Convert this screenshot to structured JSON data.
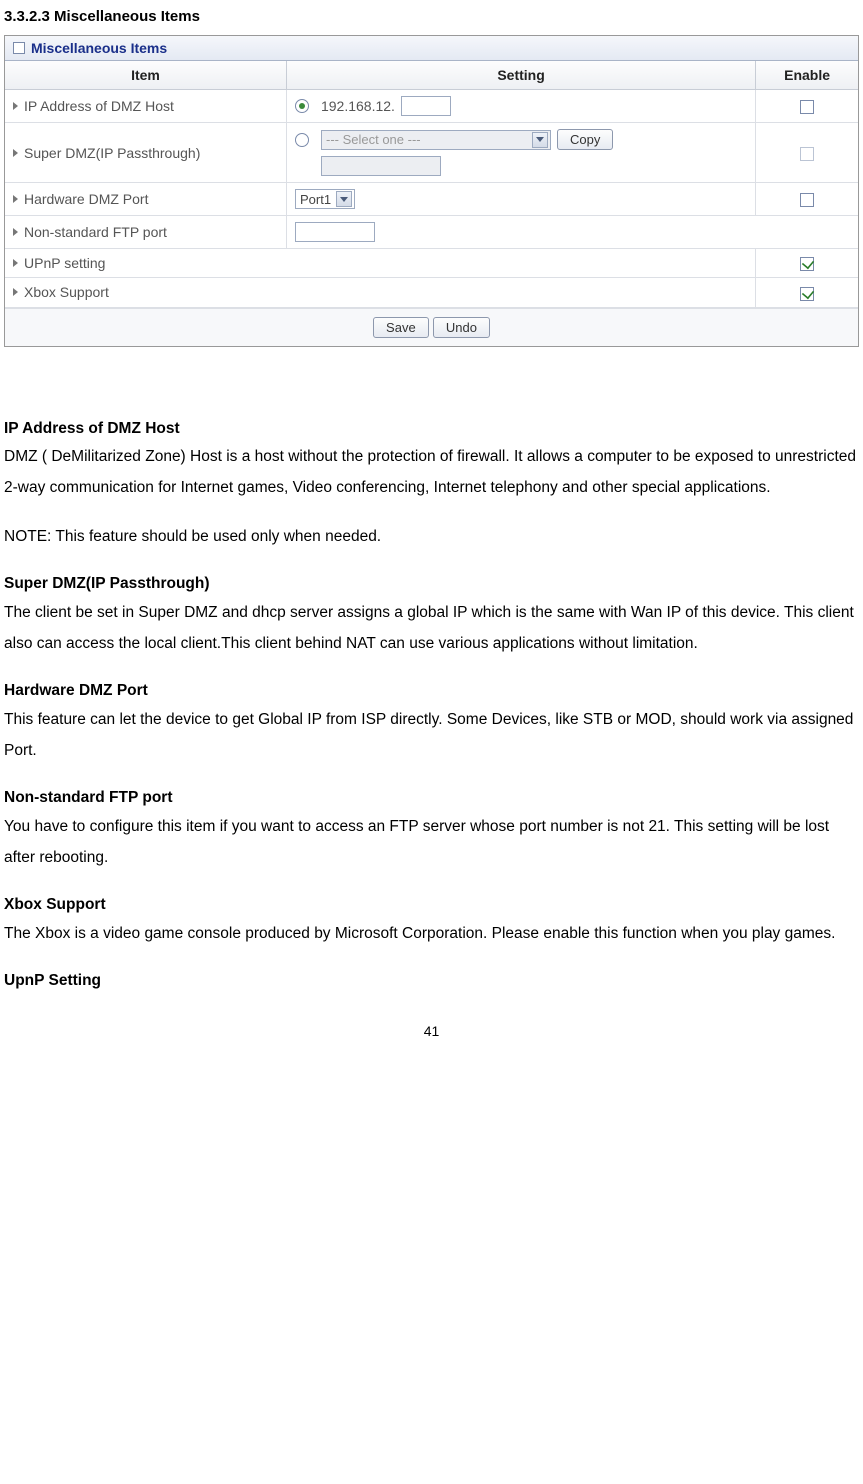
{
  "section": {
    "heading": "3.3.2.3 Miscellaneous Items"
  },
  "panel": {
    "title": "Miscellaneous Items",
    "headers": {
      "item": "Item",
      "setting": "Setting",
      "enable": "Enable"
    },
    "rows": {
      "dmz": {
        "label": "IP Address of DMZ Host",
        "ip_prefix": "192.168.12.",
        "ip_suffix_value": ""
      },
      "super_dmz": {
        "label": "Super DMZ(IP Passthrough)",
        "select_placeholder": "--- Select one ---",
        "copy_btn": "Copy",
        "text_value": ""
      },
      "hw_dmz": {
        "label": "Hardware DMZ Port",
        "port_value": "Port1"
      },
      "ftp": {
        "label": "Non-standard FTP port",
        "value": ""
      },
      "upnp": {
        "label": "UPnP setting"
      },
      "xbox": {
        "label": "Xbox Support"
      }
    },
    "buttons": {
      "save": "Save",
      "undo": "Undo"
    }
  },
  "doc": {
    "h1": "IP Address of DMZ Host",
    "p1": "DMZ ( DeMilitarized Zone) Host is a host without the protection of firewall. It allows a computer to be exposed to unrestricted 2-way communication for Internet games, Video conferencing, Internet telephony and other special applications.",
    "p2": "NOTE: This feature should be used only when needed.",
    "h2": "Super DMZ(IP Passthrough)",
    "p3": "The client be set in Super DMZ and dhcp server assigns a global IP which is the same with Wan IP of this device. This client also can access the local client.This client behind NAT can use various applications without limitation.",
    "h3": "Hardware DMZ Port",
    "p4": "This feature can let the device to get Global IP from ISP directly. Some Devices, like STB or MOD, should work via assigned Port.",
    "h4": "Non-standard FTP port",
    "p5": "You have to configure this item if you want to access an FTP server whose port number is not 21. This setting will be lost after rebooting.",
    "h5": "Xbox Support",
    "p6": "The Xbox is a video game console produced by Microsoft Corporation. Please enable this function when you play games.",
    "h6": "UpnP Setting"
  },
  "page_number": "41"
}
